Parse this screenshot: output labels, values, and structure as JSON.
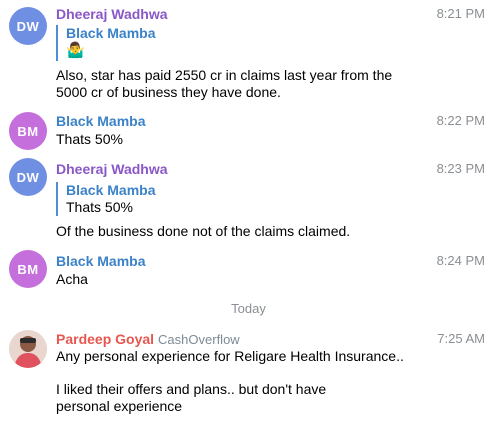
{
  "messages": [
    {
      "initials": "DW",
      "avatar_color": "#6f8fe3",
      "sender": "Dheeraj Wadhwa",
      "sender_color": "#8a57c8",
      "time": "8:21 PM",
      "reply": {
        "name": "Black Mamba",
        "text": "🤷‍♂️"
      },
      "text": "Also, star has paid 2550 cr in claims last year from the 5000 cr of business they have done."
    },
    {
      "initials": "BM",
      "avatar_color": "#c56fdc",
      "sender": "Black Mamba",
      "sender_color": "#3b82c9",
      "time": "8:22 PM",
      "text": "Thats 50%"
    },
    {
      "initials": "DW",
      "avatar_color": "#6f8fe3",
      "sender": "Dheeraj Wadhwa",
      "sender_color": "#8a57c8",
      "time": "8:23 PM",
      "reply": {
        "name": "Black Mamba",
        "text": "Thats 50%"
      },
      "text": "Of the business done not of the claims claimed."
    },
    {
      "initials": "BM",
      "avatar_color": "#c56fdc",
      "sender": "Black Mamba",
      "sender_color": "#3b82c9",
      "time": "8:24 PM",
      "text": "Acha"
    },
    {
      "sender": "Pardeep Goyal",
      "sender_color": "#e5574f",
      "sender_title": "CashOverflow",
      "time": "7:25 AM",
      "text": "Any personal experience for Religare Health Insurance..",
      "text2": "I liked their offers and plans.. but don't have personal experience"
    }
  ],
  "divider_label": "Today"
}
